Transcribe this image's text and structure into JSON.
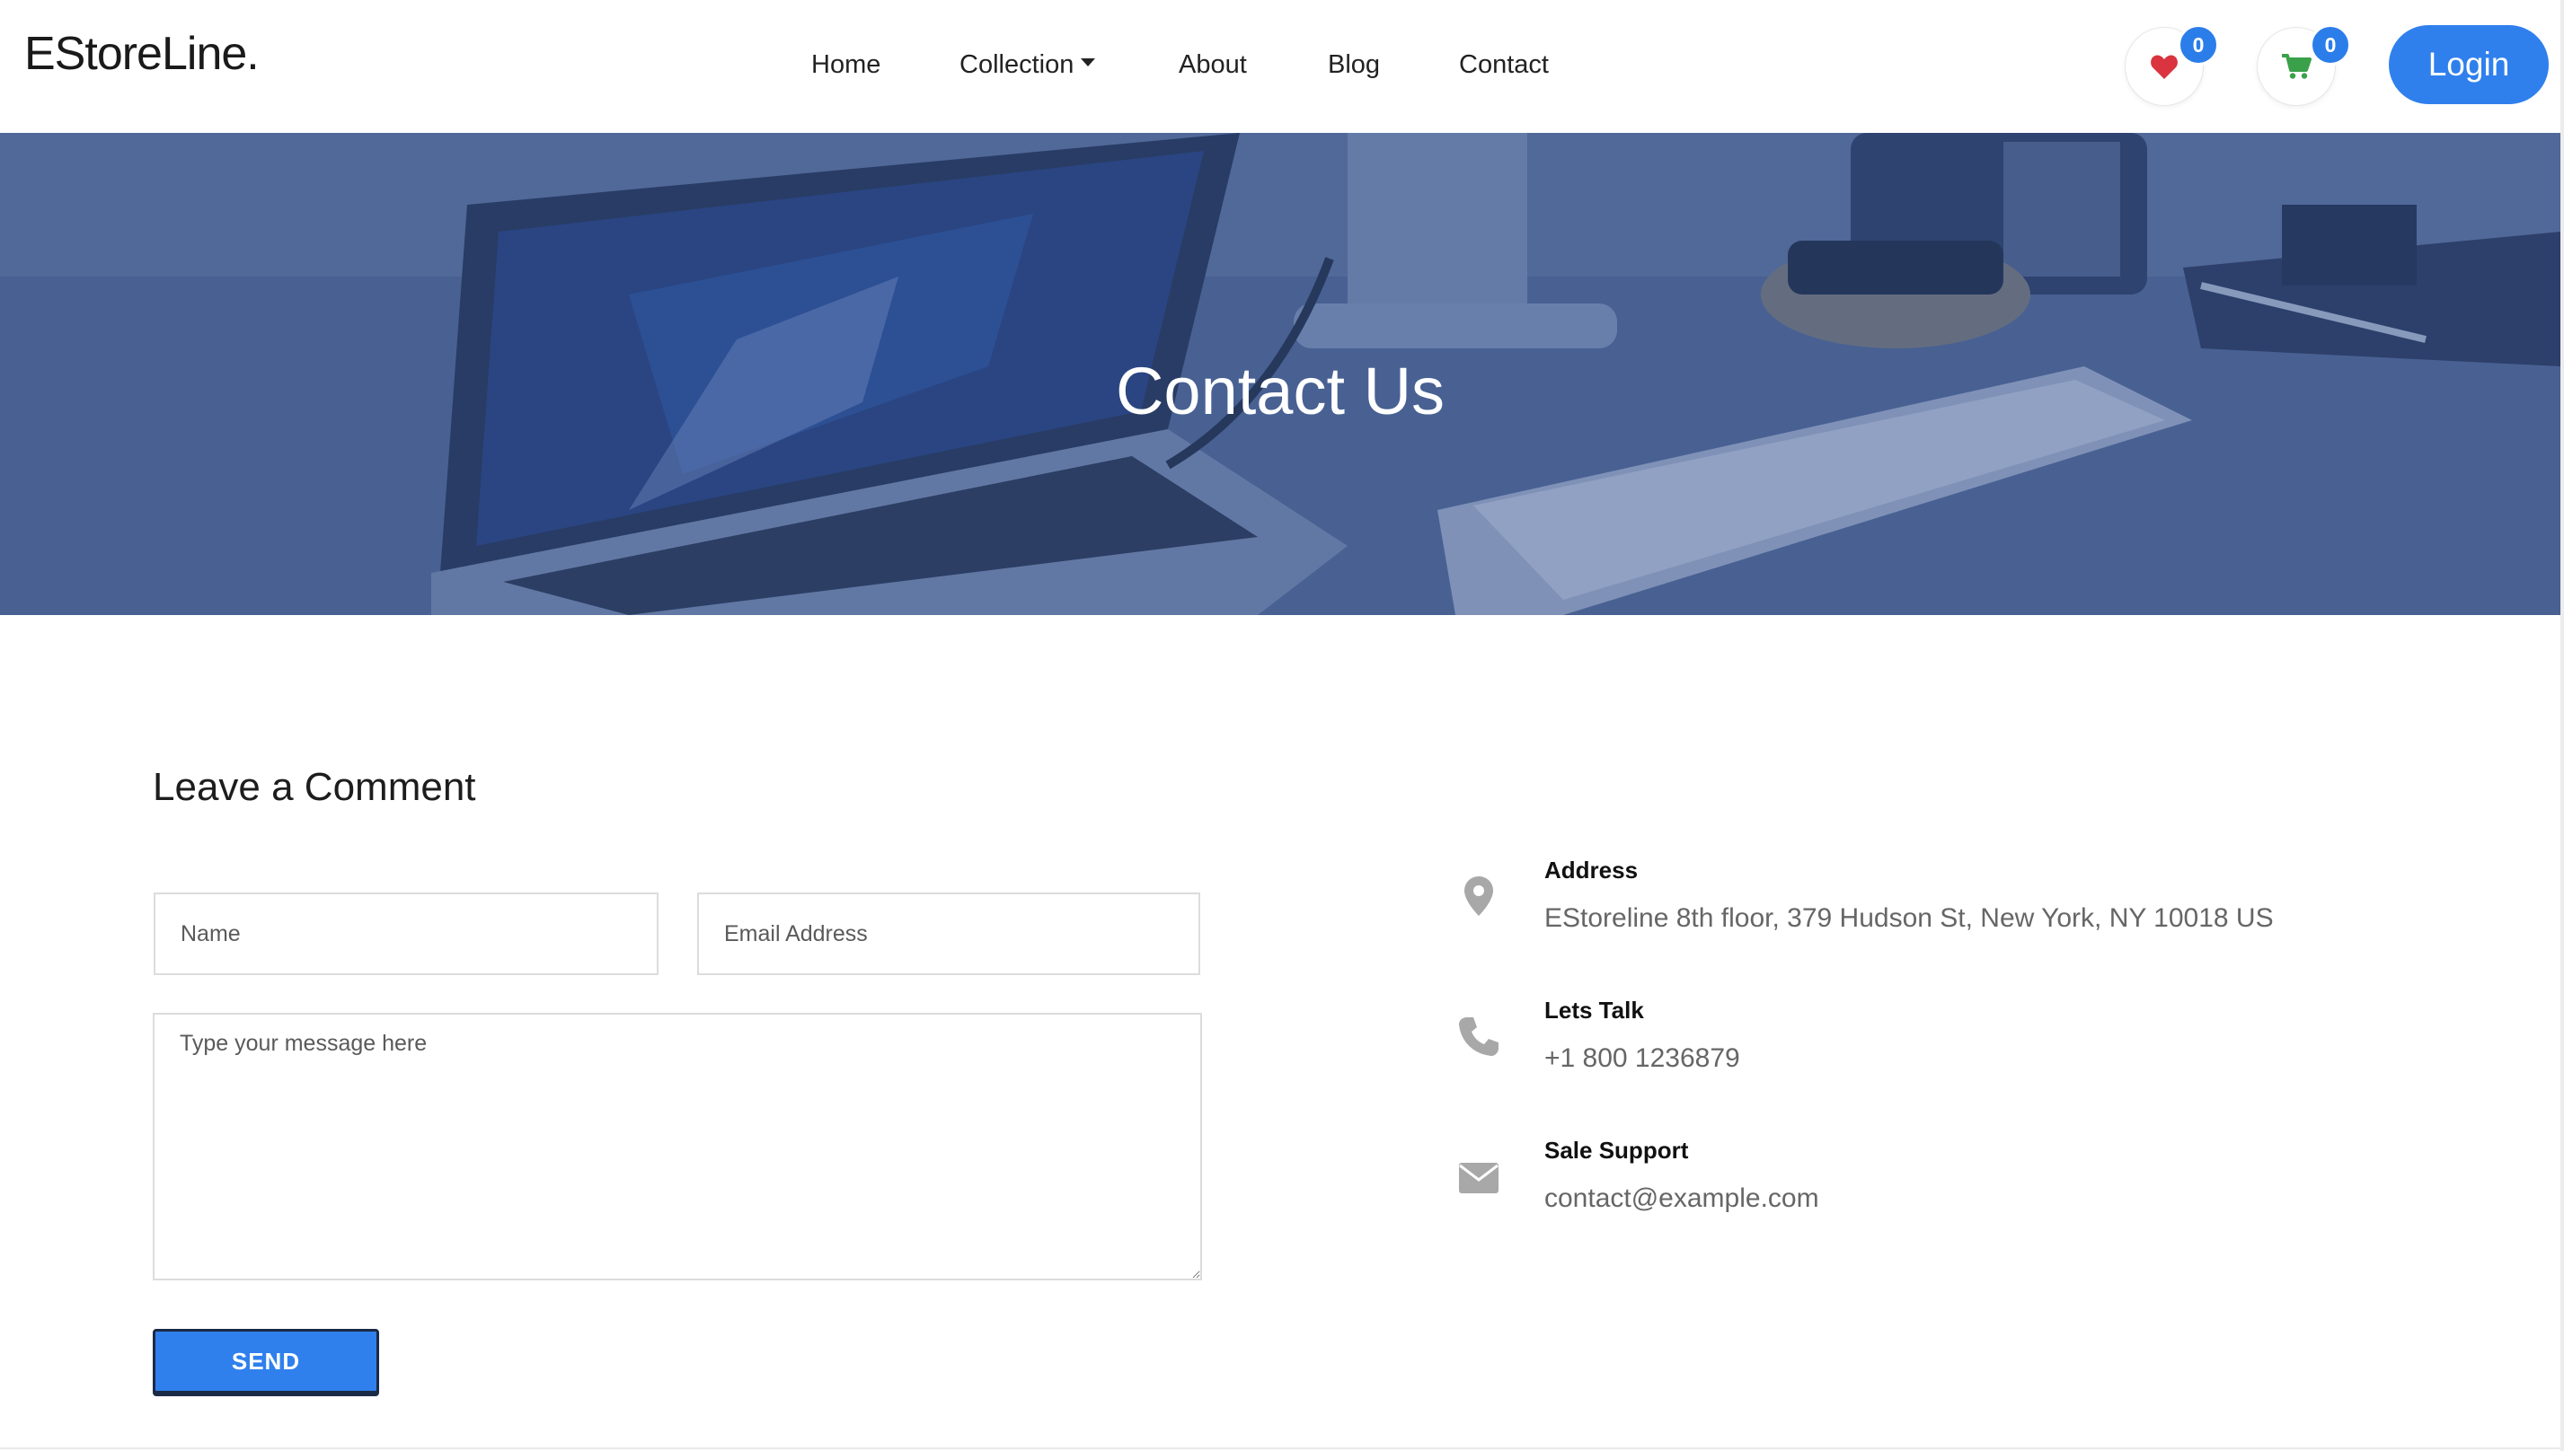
{
  "brand": "EStoreLine.",
  "nav": {
    "home": "Home",
    "collection": "Collection",
    "about": "About",
    "blog": "Blog",
    "contact": "Contact"
  },
  "header_actions": {
    "wishlist_count": "0",
    "cart_count": "0",
    "login_label": "Login",
    "wishlist_icon": "heart-icon",
    "cart_icon": "cart-icon"
  },
  "hero": {
    "title": "Contact Us"
  },
  "form": {
    "title": "Leave a Comment",
    "name_placeholder": "Name",
    "email_placeholder": "Email Address",
    "message_placeholder": "Type your message here",
    "send_label": "SEND"
  },
  "contact_info": [
    {
      "icon": "map-pin-icon",
      "label": "Address",
      "value": "EStoreline 8th floor, 379 Hudson St, New York, NY 10018 US"
    },
    {
      "icon": "phone-icon",
      "label": "Lets Talk",
      "value": "+1 800 1236879"
    },
    {
      "icon": "envelope-icon",
      "label": "Sale Support",
      "value": "contact@example.com"
    }
  ],
  "colors": {
    "primary": "#2f80ed",
    "badge": "#2b7de9",
    "heart": "#d9343f",
    "cart": "#3aa14a",
    "info_icon": "#a8a8a8"
  }
}
